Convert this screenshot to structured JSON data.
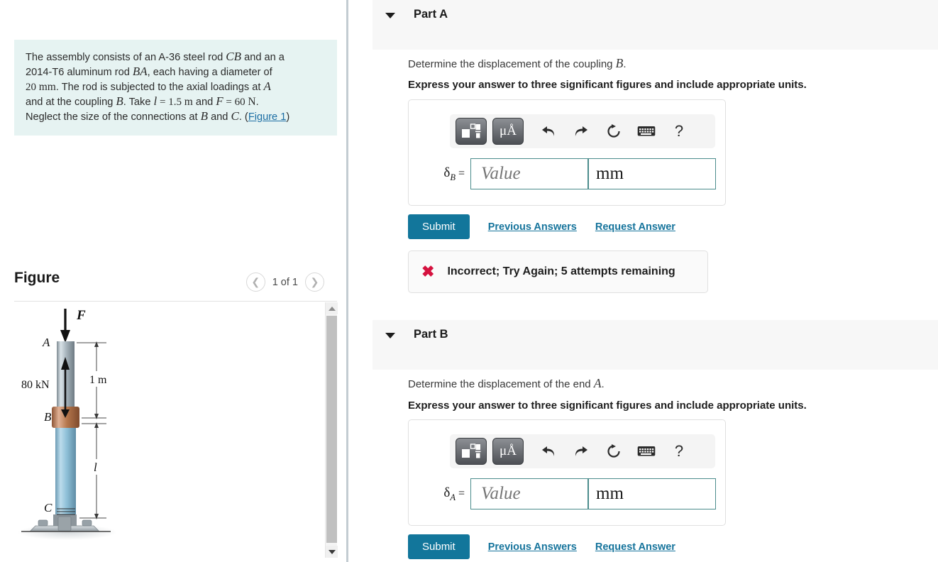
{
  "question": {
    "line1_a": "The assembly consists of an A-36 steel rod ",
    "cb": "CB",
    "line1_b": " and an a",
    "line2_a": "2014-T6 aluminum rod ",
    "ba": "BA",
    "line2_b": ", each having a diameter of",
    "line3_a": "20 ",
    "mm": "mm",
    "line3_b": ". The rod is subjected to the axial loadings at ",
    "a_pt": "A",
    "line4_a": "and at the coupling ",
    "b_pt": "B",
    "line4_b": ". Take ",
    "l_sym": "l",
    "l_val": " = 1.5 ",
    "m_unit": "m",
    "line4_c": " and ",
    "f_sym": "F",
    "f_val": " = 60 ",
    "n_unit": "N",
    "line4_d": ".",
    "line5_a": "Neglect the size of the connections at ",
    "b_pt2": "B",
    "line5_b": " and ",
    "c_pt": "C",
    "line5_c": ". (",
    "figure_link": "Figure 1",
    "line5_d": ")"
  },
  "figure": {
    "title": "Figure",
    "prev_icon": "chevron-left-icon",
    "next_icon": "chevron-right-icon",
    "counter": "1 of 1",
    "diagram": {
      "force_label": "F",
      "point_a": "A",
      "point_b": "B",
      "point_c": "C",
      "load_label": "80 kN",
      "dim_upper": "1 m",
      "dim_lower": "l"
    }
  },
  "parts": [
    {
      "caret_icon": "caret-down-icon",
      "label": "Part A",
      "prompt_pre": "Determine the displacement of the coupling ",
      "prompt_sym": "B",
      "prompt_post": ".",
      "instruction": "Express your answer to three significant figures and include appropriate units.",
      "toolbar": {
        "template_icon": "math-template-icon",
        "units_icon": "mu-angstrom-units-icon",
        "undo_icon": "undo-icon",
        "redo_icon": "redo-icon",
        "reset_icon": "reset-icon",
        "keyboard_icon": "keyboard-icon",
        "help_icon": "?"
      },
      "delta_symbol": "δ",
      "delta_subscript": "B",
      "equals": "=",
      "value_placeholder": "Value",
      "unit_value": "mm",
      "submit_label": "Submit",
      "previous_answers_label": "Previous Answers",
      "request_answer_label": "Request Answer",
      "feedback": {
        "icon": "x-mark-icon",
        "text": "Incorrect; Try Again; 5 attempts remaining"
      }
    },
    {
      "caret_icon": "caret-down-icon",
      "label": "Part B",
      "prompt_pre": "Determine the displacement of the end ",
      "prompt_sym": "A",
      "prompt_post": ".",
      "instruction": "Express your answer to three significant figures and include appropriate units.",
      "toolbar": {
        "template_icon": "math-template-icon",
        "units_icon": "mu-angstrom-units-icon",
        "undo_icon": "undo-icon",
        "redo_icon": "redo-icon",
        "reset_icon": "reset-icon",
        "keyboard_icon": "keyboard-icon",
        "help_icon": "?"
      },
      "delta_symbol": "δ",
      "delta_subscript": "A",
      "equals": "=",
      "value_placeholder": "Value",
      "unit_value": "mm",
      "submit_label": "Submit",
      "previous_answers_label": "Previous Answers",
      "request_answer_label": "Request Answer"
    }
  ],
  "colors": {
    "question_bg": "#e6f3f2",
    "submit": "#12769b",
    "link": "#16749c",
    "error": "#d5123f",
    "header_bg": "#f7f7f7"
  }
}
